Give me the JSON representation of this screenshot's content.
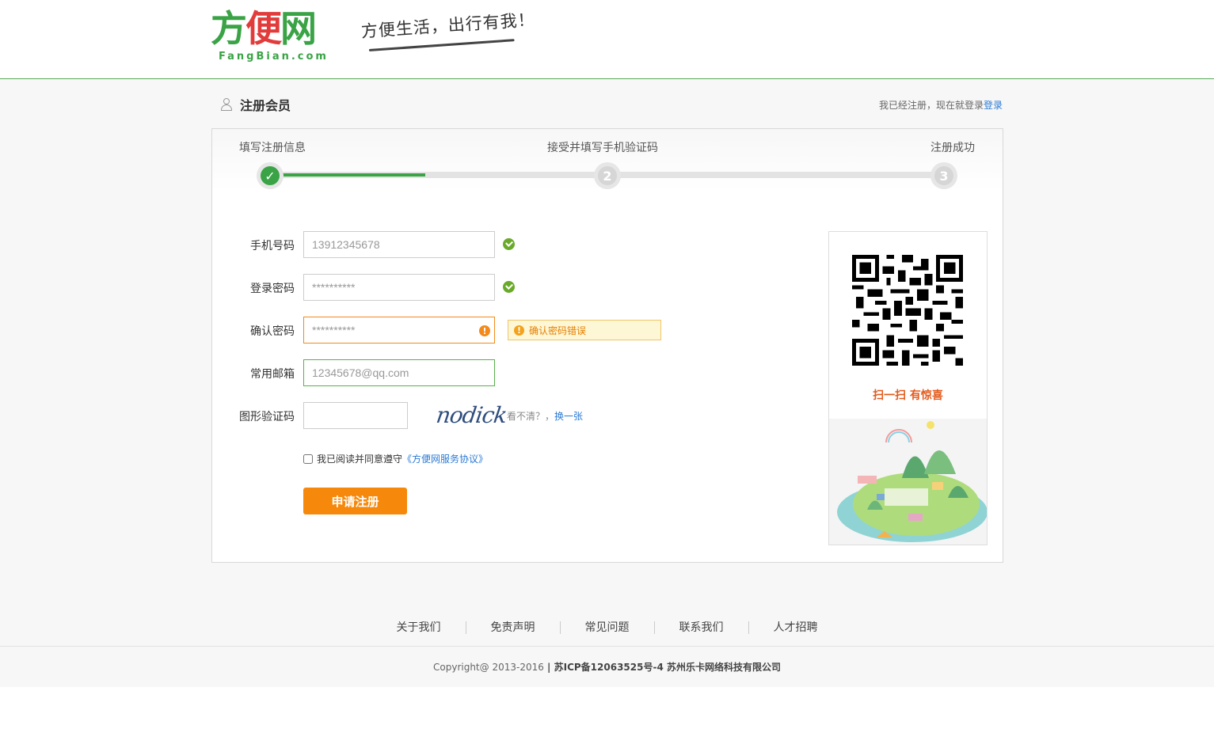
{
  "header": {
    "logo_main_1": "方",
    "logo_main_2": "便",
    "logo_main_3": "网",
    "logo_sub": "FangBian.com",
    "slogan": "方便生活，出行有我！"
  },
  "title": {
    "text": "注册会员",
    "login_prefix": "我已经注册，现在就登录",
    "login_link": "登录"
  },
  "steps": [
    {
      "label": "填写注册信息",
      "number": "✓",
      "state": "done"
    },
    {
      "label": "接受并填写手机验证码",
      "number": "2",
      "state": "todo"
    },
    {
      "label": "注册成功",
      "number": "3",
      "state": "todo"
    }
  ],
  "progress": 0.23,
  "form": {
    "phone_label": "手机号码",
    "phone_value": "13912345678",
    "password_label": "登录密码",
    "password_value": "**********",
    "confirm_label": "确认密码",
    "confirm_value": "**********",
    "confirm_error": "确认密码错误",
    "email_label": "常用邮箱",
    "email_value": "12345678@qq.com",
    "captcha_label": "图形验证码",
    "captcha_value": "",
    "captcha_image_text": "nodick",
    "captcha_hint": "看不清？，",
    "captcha_refresh": "换一张",
    "agree_text": "我已阅读并同意遵守",
    "agree_link": "《方便网服务协议》",
    "submit": "申请注册"
  },
  "side": {
    "scan_text": "扫一扫 有惊喜"
  },
  "footer": {
    "links": [
      "关于我们",
      "免责声明",
      "常见问题",
      "联系我们",
      "人才招聘"
    ],
    "copyright_prefix": "Copyright@ 2013-2016",
    "copyright_suffix": " | 苏ICP备12063525号-4 苏州乐卡网络科技有限公司"
  },
  "colors": {
    "brand_green": "#3aa346",
    "accent_orange": "#f6890b",
    "link_blue": "#2a7ad4",
    "error_orange": "#f28a1c"
  }
}
